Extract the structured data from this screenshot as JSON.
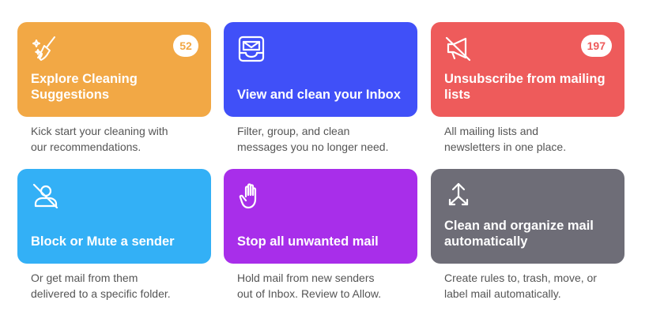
{
  "colors": {
    "orange": "#f2a845",
    "blue": "#4050f8",
    "red": "#ee5b5b",
    "sky": "#33b0f6",
    "purple": "#a82eea",
    "gray": "#6e6d77"
  },
  "tiles": [
    {
      "icon": "sparkle-broom-icon",
      "title": "Explore Cleaning Suggestions",
      "badge": "52",
      "desc_line1": "Kick start your cleaning with",
      "desc_line2": "our recommendations."
    },
    {
      "icon": "inbox-envelope-icon",
      "title": "View and clean your Inbox",
      "desc_line1": "Filter, group, and clean",
      "desc_line2": "messages you no longer need."
    },
    {
      "icon": "megaphone-off-icon",
      "title": "Unsubscribe from mailing lists",
      "badge": "197",
      "desc_line1": "All mailing lists and",
      "desc_line2": "newsletters in one place."
    },
    {
      "icon": "person-off-icon",
      "title": "Block or Mute a sender",
      "desc_line1": "Or get mail from them",
      "desc_line2": "delivered to a specific folder."
    },
    {
      "icon": "hand-stop-icon",
      "title": "Stop all unwanted mail",
      "desc_line1": "Hold mail from new senders",
      "desc_line2": "out of Inbox. Review to Allow."
    },
    {
      "icon": "arrows-split-icon",
      "title": "Clean and organize mail automatically",
      "desc_line1": "Create rules to, trash, move, or",
      "desc_line2": "label mail automatically."
    }
  ]
}
